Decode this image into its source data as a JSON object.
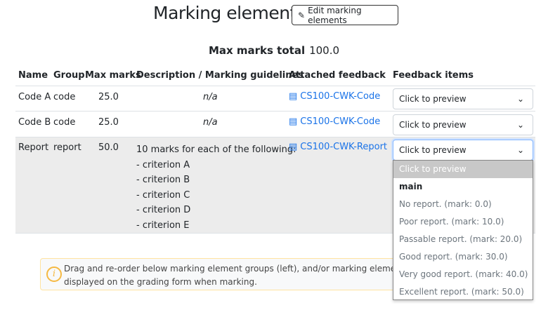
{
  "title": "Marking elements",
  "edit_button": "Edit marking elements",
  "max_total_label": "Max marks total",
  "max_total_value": "100.0",
  "columns": [
    "Name",
    "Group",
    "Max marks",
    "Description / Marking guidelines",
    "Attached feedback",
    "Feedback items"
  ],
  "rows": [
    {
      "name": "Code A",
      "group": "code",
      "max": "25.0",
      "description": "n/a",
      "feedback": "CS100-CWK-Code",
      "select": "Click to preview"
    },
    {
      "name": "Code B",
      "group": "code",
      "max": "25.0",
      "description": "n/a",
      "feedback": "CS100-CWK-Code",
      "select": "Click to preview"
    },
    {
      "name": "Report",
      "group": "report",
      "max": "50.0",
      "description": "10 marks for each of the following:",
      "criteria": [
        "- criterion A",
        "- criterion B",
        "- criterion C",
        "- criterion D",
        "- criterion E"
      ],
      "feedback": "CS100-CWK-Report",
      "select": "Click to preview"
    }
  ],
  "dropdown": {
    "options": [
      "Click to preview",
      "main",
      "No report. (mark: 0.0)",
      "Poor report. (mark: 10.0)",
      "Passable report. (mark: 20.0)",
      "Good report. (mark: 30.0)",
      "Very good report. (mark: 40.0)",
      "Excellent report. (mark: 50.0)"
    ]
  },
  "info": {
    "line1": "Drag and re-order below marking element groups (left), and/or marking elements (right) t",
    "line2": "displayed on the grading form when marking."
  }
}
